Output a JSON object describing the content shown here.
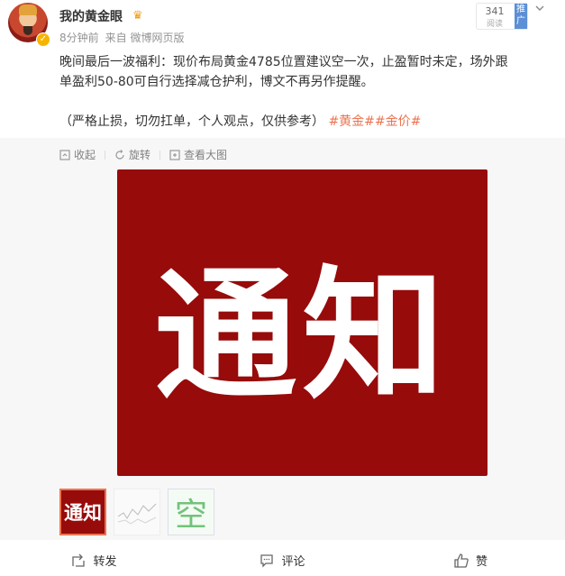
{
  "post": {
    "username": "我的黄金眼",
    "time": "8分钟前",
    "source": "来自 微博网页版",
    "text_line1": "晚间最后一波福利：现价布局黄金4785位置建议空一次，止盈暂时未定，场外跟",
    "text_line2": "单盈利50-80可自行选择减仓护利，博文不再另作提醒。",
    "text_disclaimer": "（严格止损，切勿扛单，个人观点，仅供参考）",
    "hashtag": "#黄金##金价#"
  },
  "ad": {
    "count": "341",
    "sub": "阅读",
    "tag": "推广"
  },
  "toolbar": {
    "collapse": "收起",
    "rotate": "旋转",
    "view_large": "查看大图"
  },
  "image": {
    "text": "通知"
  },
  "thumbs": {
    "t1": "通知",
    "t3": "空"
  },
  "actions": {
    "forward": "转发",
    "comment": "评论",
    "like": "赞"
  },
  "colors": {
    "accent": "#eb7350",
    "image_bg": "#970b0b",
    "ad_tag": "#5b8fd6"
  }
}
